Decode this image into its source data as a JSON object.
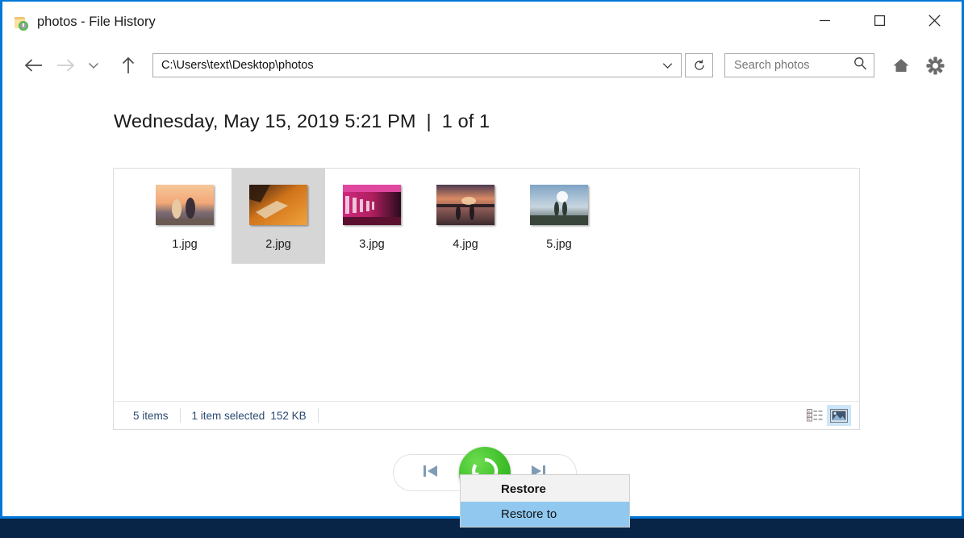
{
  "window": {
    "title": "photos - File History",
    "app_icon": "folder-history-icon",
    "accent_color": "#0078d7",
    "controls": {
      "minimize": "minimize-icon",
      "maximize": "maximize-icon",
      "close": "close-icon"
    }
  },
  "navbar": {
    "back": "back-arrow-icon",
    "forward": "forward-arrow-icon",
    "recent": "chevron-down-icon",
    "up": "up-arrow-icon",
    "address": {
      "value": "C:\\Users\\text\\Desktop\\photos",
      "dropdown": "chevron-down-icon"
    },
    "refresh": "refresh-icon",
    "search": {
      "placeholder": "Search photos",
      "icon": "search-icon"
    },
    "home": "home-icon",
    "settings": "gear-icon"
  },
  "content": {
    "date_label": "Wednesday, May 15, 2019 5:21 PM",
    "separator": "|",
    "position_label": "1 of 1"
  },
  "files": [
    {
      "name": "1.jpg",
      "selected": false,
      "thumb": "couple-sunset-photo"
    },
    {
      "name": "2.jpg",
      "selected": true,
      "thumb": "orange-bench-photo"
    },
    {
      "name": "3.jpg",
      "selected": false,
      "thumb": "pink-tunnel-photo"
    },
    {
      "name": "4.jpg",
      "selected": false,
      "thumb": "city-dusk-photo"
    },
    {
      "name": "5.jpg",
      "selected": false,
      "thumb": "cliff-people-photo"
    }
  ],
  "statusbar": {
    "item_count": "5 items",
    "selection": "1 item selected",
    "size": "152 KB",
    "details_view": "details-view-icon",
    "large_icons_view": "large-icons-view-icon"
  },
  "bottom_controls": {
    "previous": "previous-version-icon",
    "restore": "restore-icon",
    "next": "next-version-icon",
    "restore_color": "#3fbf2a"
  },
  "context_menu": {
    "items": [
      {
        "label": "Restore",
        "bold": true,
        "highlighted": false
      },
      {
        "label": "Restore to",
        "bold": false,
        "highlighted": true
      }
    ],
    "highlight_color": "#90c8f0"
  }
}
